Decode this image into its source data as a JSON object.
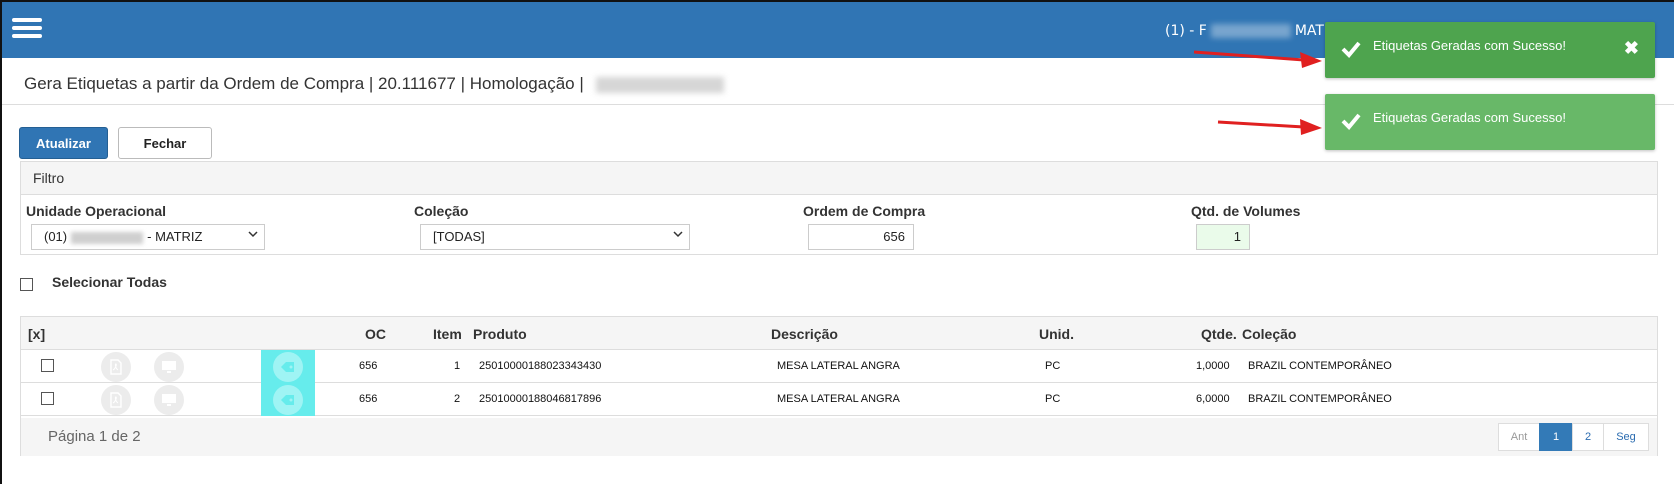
{
  "header": {
    "user_prefix": "(1) - F",
    "user_suffix": "MAT"
  },
  "page": {
    "title": "Gera Etiquetas a partir da Ordem de Compra | 20.111677 | Homologação | "
  },
  "toolbar": {
    "refresh_label": "Atualizar",
    "close_label": "Fechar"
  },
  "filter": {
    "heading": "Filtro",
    "unidade": {
      "label": "Unidade Operacional",
      "value_prefix": "(01)",
      "value_suffix": "- MATRIZ"
    },
    "colecao": {
      "label": "Coleção",
      "value": "[TODAS]"
    },
    "ordem": {
      "label": "Ordem de Compra",
      "value": "656"
    },
    "volumes": {
      "label": "Qtd. de Volumes",
      "value": "1"
    }
  },
  "select_all": {
    "label": "Selecionar Todas"
  },
  "table": {
    "headers": {
      "check": "[x]",
      "oc": "OC",
      "item": "Item",
      "produto": "Produto",
      "descricao": "Descrição",
      "unid": "Unid.",
      "qtde": "Qtde.",
      "colecao": "Coleção"
    },
    "rows": [
      {
        "oc": "656",
        "item": "1",
        "produto": "25010000188023343430",
        "descricao": "MESA LATERAL ANGRA",
        "unid": "PC",
        "qtde": "1,0000",
        "colecao": "BRAZIL CONTEMPORÂNEO"
      },
      {
        "oc": "656",
        "item": "2",
        "produto": "25010000188046817896",
        "descricao": "MESA LATERAL ANGRA",
        "unid": "PC",
        "qtde": "6,0000",
        "colecao": "BRAZIL CONTEMPORÂNEO"
      }
    ],
    "page_info": "Página 1 de 2",
    "pager": {
      "prev": "Ant",
      "p1": "1",
      "p2": "2",
      "next": "Seg"
    }
  },
  "toasts": [
    {
      "message": "Etiquetas Geradas com Sucesso!",
      "close": "✖"
    },
    {
      "message": "Etiquetas Geradas com Sucesso!"
    }
  ],
  "colors": {
    "header_bg": "#3075b4",
    "toast_success": "#4ea44e",
    "toast_success_fading": "#68b868",
    "highlight_cell": "#66ecec",
    "annotation_arrow": "#e02020"
  },
  "icons": [
    "menu-icon",
    "pdf-file-icon",
    "monitor-icon",
    "tag-icon",
    "check-icon",
    "close-icon",
    "chevron-down-icon"
  ]
}
